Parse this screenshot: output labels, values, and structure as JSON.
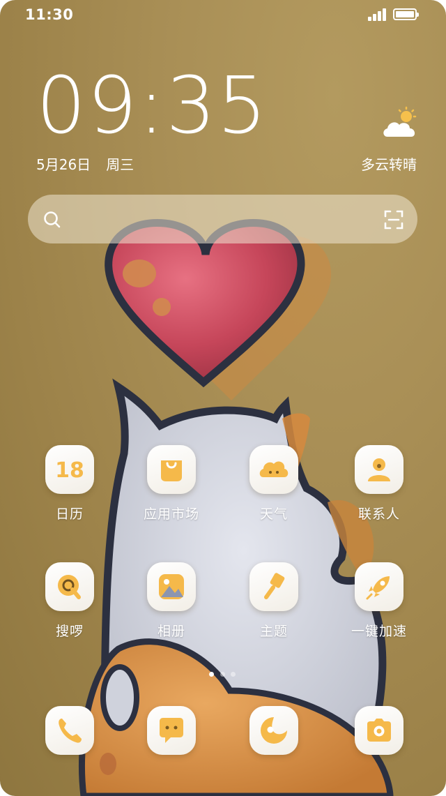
{
  "status_bar": {
    "time": "11:30",
    "signal_icon": "signal-icon",
    "battery_icon": "battery-icon"
  },
  "lock": {
    "clock": "09:35",
    "date": "5月26日",
    "weekday": "周三",
    "weather": "多云转晴",
    "weather_icon": "partly-cloudy-icon"
  },
  "search": {
    "icon": "search-icon",
    "scan_icon": "scan-icon"
  },
  "apps": [
    {
      "label": "日历",
      "icon": "calendar-icon",
      "badge": "18"
    },
    {
      "label": "应用市场",
      "icon": "app-store-bag-icon"
    },
    {
      "label": "天气",
      "icon": "weather-cloud-icon"
    },
    {
      "label": "联系人",
      "icon": "contacts-person-icon"
    },
    {
      "label": "搜啰",
      "icon": "search-app-icon"
    },
    {
      "label": "相册",
      "icon": "gallery-icon"
    },
    {
      "label": "主题",
      "icon": "theme-brush-icon"
    },
    {
      "label": "一键加速",
      "icon": "rocket-boost-icon"
    }
  ],
  "dock": [
    {
      "icon": "phone-icon"
    },
    {
      "icon": "messages-icon"
    },
    {
      "icon": "browser-icon"
    },
    {
      "icon": "camera-icon"
    }
  ],
  "page_indicator": {
    "pages": 3,
    "current": 1
  },
  "colors": {
    "accent": "#f5b94a",
    "wallpaper": "#a98f56",
    "heart": "#c84a5a"
  }
}
